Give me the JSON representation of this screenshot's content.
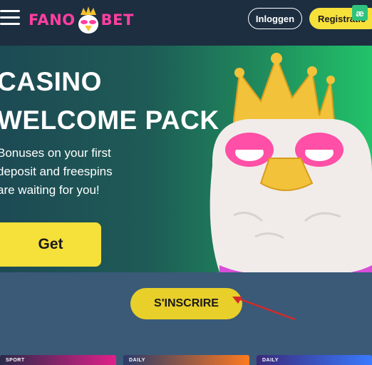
{
  "header": {
    "logo_left": "FANO",
    "logo_right": "BET",
    "login_label": "Inloggen",
    "register_label": "Registratie",
    "extension_badge": "æ"
  },
  "hero": {
    "title_line1": "CASINO",
    "title_line2": "WELCOME PACK",
    "subtitle": "Bonuses on your first deposit and freespins are waiting for you!",
    "cta_label": "Get"
  },
  "signup": {
    "label": "S'INSCRIRE"
  },
  "cards": [
    {
      "label": "SPORT"
    },
    {
      "label": "DAILY"
    },
    {
      "label": "DAILY"
    }
  ],
  "colors": {
    "brand_pink": "#ff3fa0",
    "accent_yellow": "#f6e03a",
    "header_bg": "#1d2e41",
    "page_bg": "#3a5a78",
    "arrow_red": "#d42a2a"
  }
}
